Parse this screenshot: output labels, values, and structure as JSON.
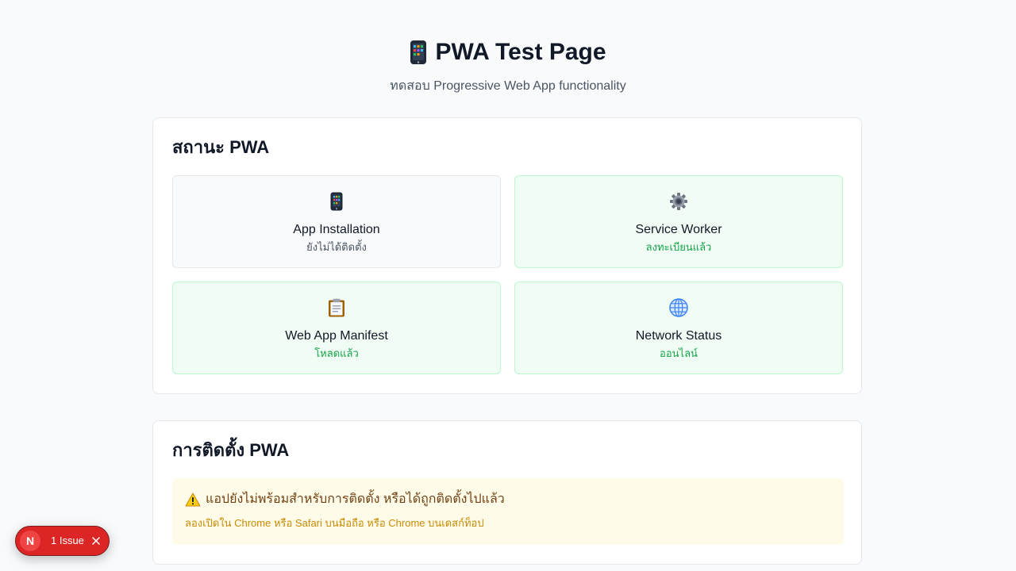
{
  "header": {
    "title": "PWA Test Page",
    "subtitle": "ทดสอบ Progressive Web App functionality",
    "icon": "mobile-phone-icon"
  },
  "status_section": {
    "title": "สถานะ PWA",
    "items": [
      {
        "icon": "mobile-phone-icon",
        "label": "App Installation",
        "status": "ยังไม่ได้ติดตั้ง",
        "state": "neutral"
      },
      {
        "icon": "gear-icon",
        "label": "Service Worker",
        "status": "ลงทะเบียนแล้ว",
        "state": "ok"
      },
      {
        "icon": "clipboard-icon",
        "label": "Web App Manifest",
        "status": "โหลดแล้ว",
        "state": "ok"
      },
      {
        "icon": "globe-icon",
        "label": "Network Status",
        "status": "ออนไลน์",
        "state": "ok"
      }
    ]
  },
  "install_section": {
    "title": "การติดตั้ง PWA",
    "warning": {
      "icon": "warning-icon",
      "title": "แอปยังไม่พร้อมสำหรับการติดตั้ง หรือได้ถูกติดตั้งไปแล้ว",
      "hint": "ลองเปิดใน Chrome หรือ Safari บนมือถือ หรือ Chrome บนเดสก์ท็อป"
    }
  },
  "dev_indicator": {
    "logo": "N",
    "issues_label": "1 Issue"
  },
  "colors": {
    "ok_text": "#16a34a",
    "ok_background": "#f0fdf4",
    "ok_border": "#bbf7d0",
    "warning_background": "#fefce8",
    "warning_title": "#713f12",
    "warning_hint": "#ca8a04",
    "issue_pill": "#dc2626"
  }
}
